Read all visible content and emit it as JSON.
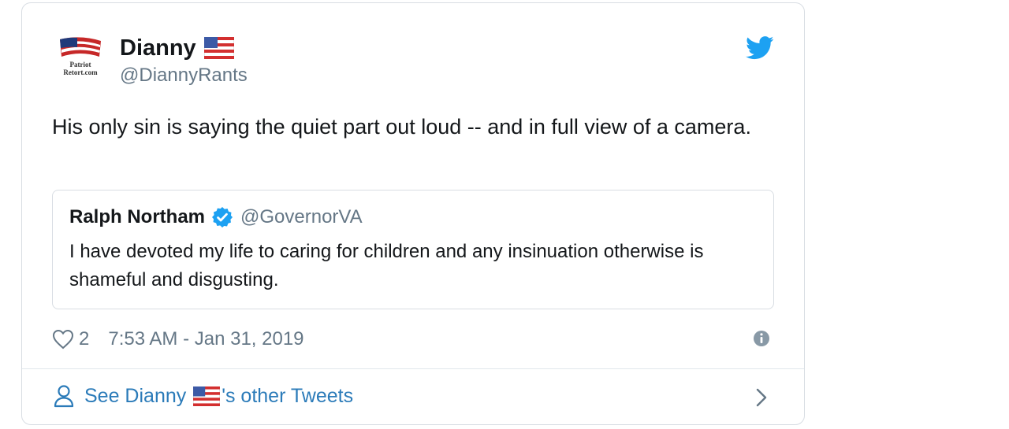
{
  "author": {
    "display_name": "Dianny",
    "handle": "@DiannyRants",
    "avatar_label": "Patriot Retort.com"
  },
  "tweet": {
    "text": "His only sin is saying the quiet part out loud -- and in full view of a camera.",
    "likes": "2",
    "timestamp": "7:53 AM - Jan 31, 2019"
  },
  "quoted": {
    "name": "Ralph Northam",
    "handle": "@GovernorVA",
    "text": "I have devoted my life to caring for children and any insinuation otherwise is shameful and disgusting."
  },
  "footer": {
    "prefix": "See Dianny ",
    "suffix": "'s other Tweets"
  },
  "icons": {
    "bird": "twitter-bird-icon",
    "verified": "verified-badge-icon",
    "heart": "heart-icon",
    "info": "info-icon",
    "person": "person-icon",
    "chevron": "chevron-right-icon",
    "flag": "us-flag-icon"
  },
  "colors": {
    "brand_blue": "#1da1f2",
    "link_blue": "#2b7bb9",
    "muted": "#657786",
    "text": "#14171a",
    "border": "#d8dde3"
  }
}
